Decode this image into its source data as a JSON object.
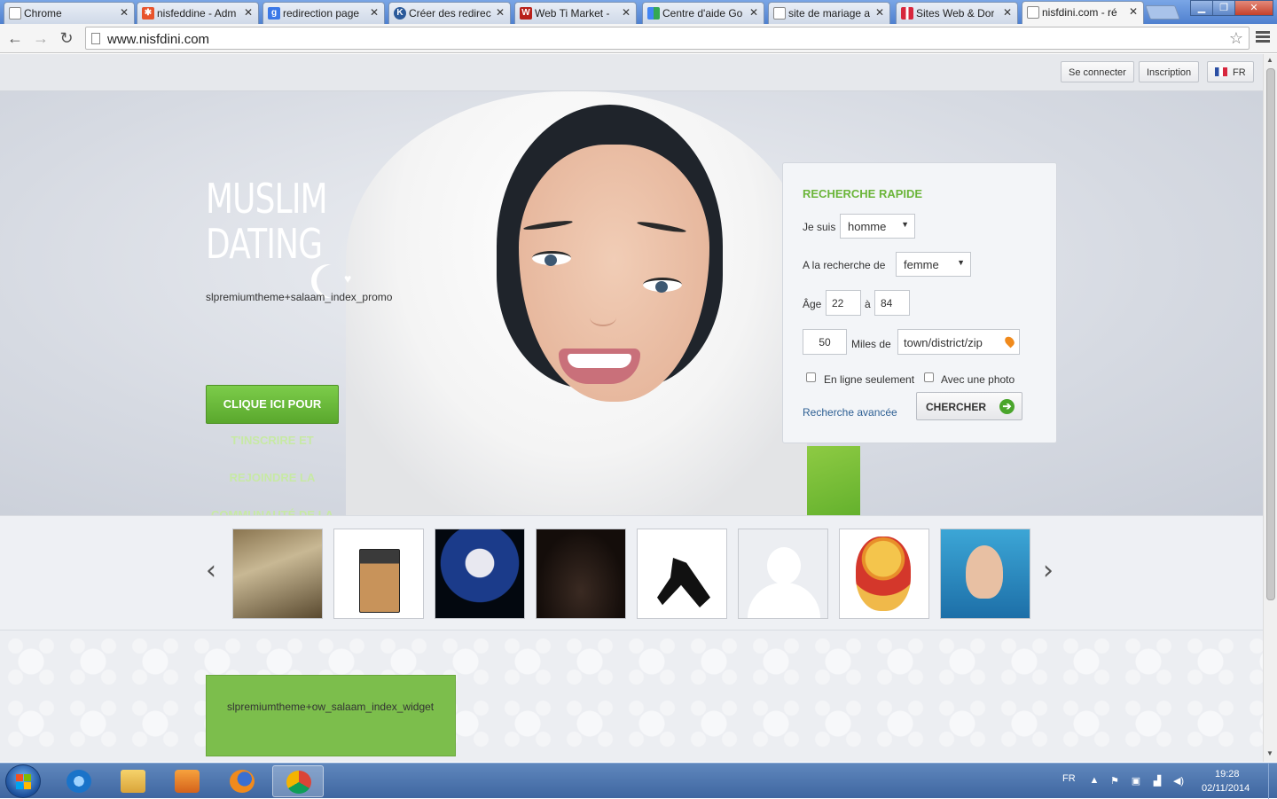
{
  "browser": {
    "tabs": [
      {
        "label": "Chrome",
        "favicon": "page-icon",
        "active": false
      },
      {
        "label": "nisfeddine - Adm",
        "favicon": "joomla-icon",
        "active": false
      },
      {
        "label": "redirection page",
        "favicon": "google-icon",
        "active": false
      },
      {
        "label": "Créer des redirec",
        "favicon": "ovh-icon",
        "active": false
      },
      {
        "label": "Web Ti Market -",
        "favicon": "w-icon",
        "active": false
      },
      {
        "label": "Centre d'aide Go",
        "favicon": "google-icon",
        "active": false
      },
      {
        "label": "site de mariage a",
        "favicon": "page-icon",
        "active": false
      },
      {
        "label": "Sites Web & Dor",
        "favicon": "flag-icon",
        "active": false
      },
      {
        "label": "nisfdini.com - ré",
        "favicon": "page-icon",
        "active": true
      }
    ],
    "url": "www.nisfdini.com"
  },
  "topbar": {
    "login_label": "Se connecter",
    "register_label": "Inscription",
    "language_label": "FR"
  },
  "hero": {
    "logo_line1": "MUSLIM",
    "logo_line2": "DATING",
    "promo_text": "slpremiumtheme+salaam_index_promo",
    "cta_line1": "CLIQUE ICI POUR",
    "cta_line2": "T'INSCRIRE ET",
    "cta_line3": "REJOINDRE LA",
    "cta_line4": "COMMUNAUTÉ DE LA"
  },
  "quick_search": {
    "title": "RECHERCHE RAPIDE",
    "i_am_label": "Je suis",
    "i_am_value": "homme",
    "looking_for_label": "A la recherche de",
    "looking_for_value": "femme",
    "age_label": "Âge",
    "age_from": "22",
    "age_to_label": "à",
    "age_to": "84",
    "distance_value": "50",
    "distance_label": "Miles de",
    "location_placeholder": "town/district/zip",
    "online_only_label": "En ligne seulement",
    "with_photo_label": "Avec une photo",
    "advanced_label": "Recherche avancée",
    "search_button_label": "CHERCHER"
  },
  "member_strip": {
    "prev_arrow": "‹",
    "next_arrow": "›",
    "thumbnails": [
      "member-photo-vintage",
      "member-photo-perfume",
      "member-photo-moon",
      "member-photo-night",
      "member-photo-ninja",
      "member-photo-default-avatar",
      "member-photo-winnie",
      "member-photo-child-pool"
    ]
  },
  "widget": {
    "text": "slpremiumtheme+ow_salaam_index_widget"
  },
  "taskbar": {
    "language": "FR",
    "time": "19:28",
    "date": "02/11/2014",
    "apps": [
      "internet-explorer-icon",
      "file-explorer-icon",
      "media-player-icon",
      "firefox-icon",
      "chrome-icon"
    ]
  },
  "colors": {
    "accent_green": "#6bb53a",
    "cta_green": "#5aa82d",
    "link_blue": "#2d5f93"
  }
}
